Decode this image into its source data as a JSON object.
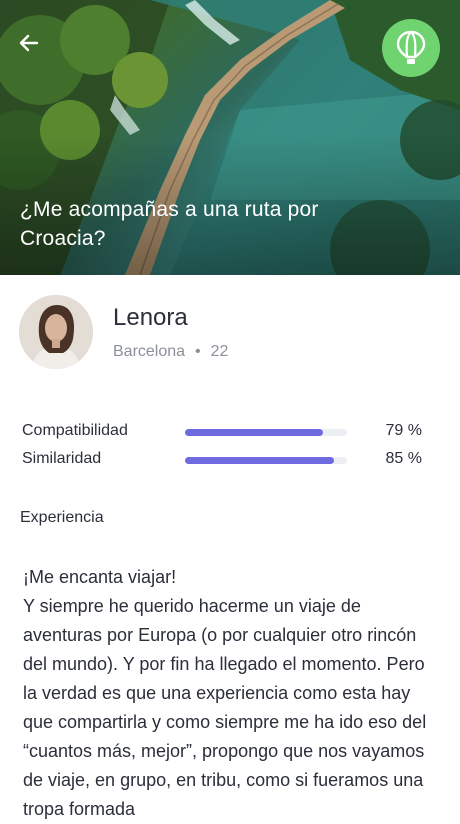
{
  "hero": {
    "title": "¿Me acompañas a una ruta por Croacia?",
    "back_icon": "arrow-left-icon",
    "brand_icon": "hot-air-balloon-icon",
    "brand_color": "#6fd36f"
  },
  "profile": {
    "name": "Lenora",
    "city": "Barcelona",
    "separator": "•",
    "age": "22"
  },
  "stats": [
    {
      "label": "Compatibilidad",
      "value": "79 %",
      "fraction": 0.85
    },
    {
      "label": "Similaridad",
      "value": "85 %",
      "fraction": 0.92
    }
  ],
  "stat_bar_color": "#6f6ae0",
  "experience": {
    "label": "Experiencia",
    "text": "¡Me encanta viajar!\nY siempre he querido hacerme un viaje de aventuras por Europa (o por cualquier otro rincón del mundo). Y por fin ha llegado el momento. Pero la verdad es que una experiencia como esta hay que compartirla y como siempre me ha ido eso del “cuantos más, mejor”, propongo que nos vayamos de viaje, en grupo, en tribu, como si fueramos una tropa formada"
  }
}
